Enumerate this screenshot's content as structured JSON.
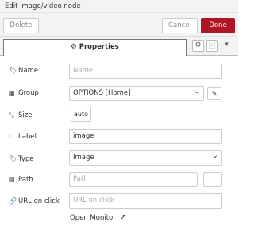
{
  "dialog": {
    "title": "Edit image/video node"
  },
  "toolbar": {
    "delete_label": "Delete",
    "cancel_label": "Cancel",
    "done_label": "Done"
  },
  "tabs": {
    "properties_label": "Properties"
  },
  "icons": {
    "gear": "⚙",
    "doc": "📄",
    "more": "▾",
    "tag": "🏷",
    "table": "▦",
    "size": "⤡",
    "cursor": "I",
    "path": "▤",
    "link": "🔗",
    "pencil": "✎",
    "external": "↗"
  },
  "form": {
    "name": {
      "label": "Name",
      "placeholder": "Name"
    },
    "group": {
      "label": "Group",
      "value": "OPTIONS [Home]"
    },
    "size": {
      "label": "Size",
      "value": "auto"
    },
    "text_label": {
      "label": "Label",
      "value": "image"
    },
    "type": {
      "label": "Type",
      "value": "Image"
    },
    "path": {
      "label": "Path",
      "placeholder": "Path",
      "browse_label": "..."
    },
    "url_on_click": {
      "label": "URL on click",
      "placeholder": "URL on click"
    }
  },
  "footer": {
    "open_monitor_label": "Open Monitor"
  },
  "colors": {
    "done_button": "#ad1625",
    "toolbar_bg": "#f3f3f3"
  }
}
